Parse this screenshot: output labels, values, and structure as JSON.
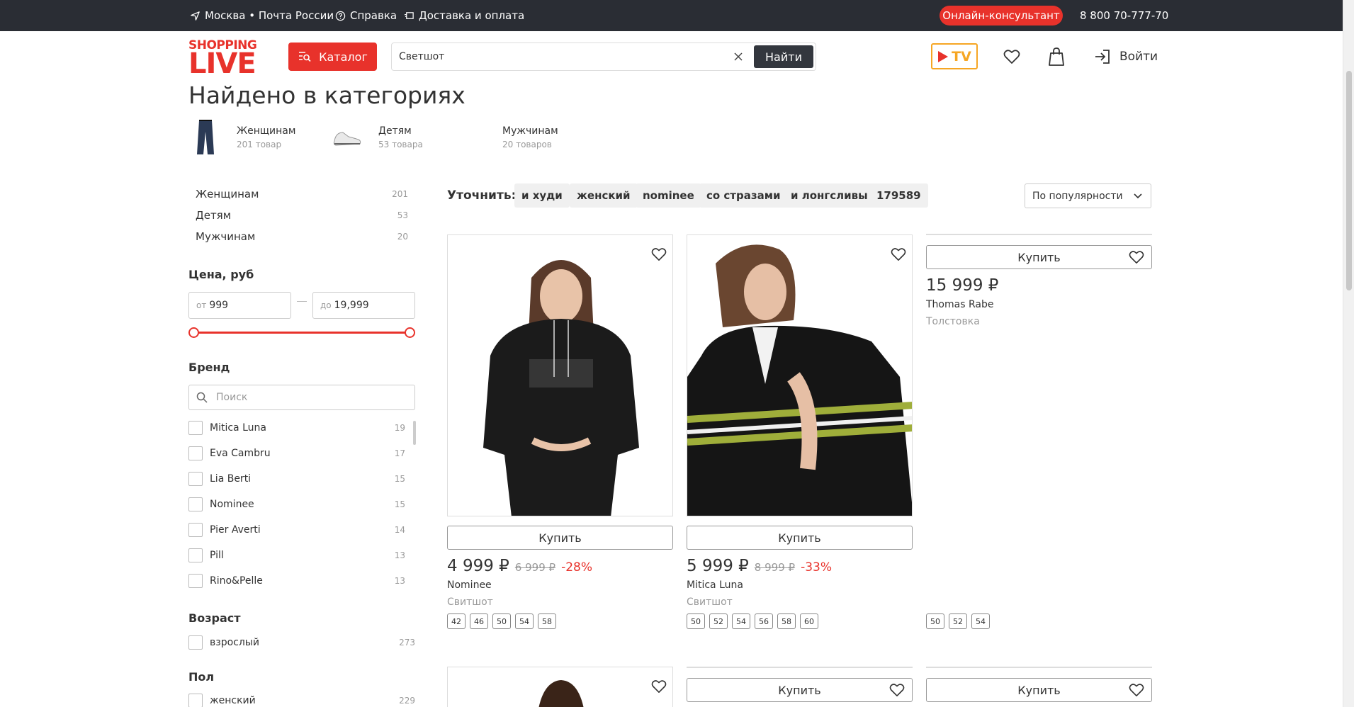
{
  "topbar": {
    "location": "Москва • Почта России",
    "help": "Справка",
    "delivery": "Доставка и оплата",
    "consultant": "Онлайн-консультант",
    "phone": "8 800 70-777-70"
  },
  "header": {
    "logo_top": "SHOPPING",
    "logo_bottom": "LIVE",
    "catalog_label": "Каталог",
    "search_value": "Светшот",
    "search_button": "Найти",
    "tv_label": "TV",
    "login_label": "Войти"
  },
  "page_title": "Найдено в категориях",
  "found_categories": [
    {
      "name": "Женщинам",
      "count": "201 товар"
    },
    {
      "name": "Детям",
      "count": "53 товара"
    },
    {
      "name": "Мужчинам",
      "count": "20 товаров"
    }
  ],
  "sidebar": {
    "categories": [
      {
        "name": "Женщинам",
        "count": "201"
      },
      {
        "name": "Детям",
        "count": "53"
      },
      {
        "name": "Мужчинам",
        "count": "20"
      }
    ],
    "price_heading": "Цена, руб",
    "price_from_prefix": "от",
    "price_from": "999",
    "price_to_prefix": "до",
    "price_to": "19,999",
    "brand_heading": "Бренд",
    "brand_search_placeholder": "Поиск",
    "brands": [
      {
        "name": "Mitica Luna",
        "count": "19"
      },
      {
        "name": "Eva Cambru",
        "count": "17"
      },
      {
        "name": "Lia Berti",
        "count": "15"
      },
      {
        "name": "Nominee",
        "count": "15"
      },
      {
        "name": "Pier Averti",
        "count": "14"
      },
      {
        "name": "Pill",
        "count": "13"
      },
      {
        "name": "Rino&Pelle",
        "count": "13"
      }
    ],
    "age_heading": "Возраст",
    "age_options": [
      {
        "name": "взрослый",
        "count": "273"
      }
    ],
    "gender_heading": "Пол",
    "gender_options": [
      {
        "name": "женский",
        "count": "229"
      }
    ]
  },
  "refine": {
    "label": "Уточнить:",
    "chips": [
      "и худи",
      "женский",
      "nominee",
      "со стразами",
      "и лонгсливы",
      "179589"
    ],
    "sort_value": "По популярности"
  },
  "products": [
    {
      "buy": "Купить",
      "price": "4 999 ₽",
      "old_price": "6 999 ₽",
      "discount": "-28%",
      "brand": "Nominee",
      "type": "Свитшот",
      "sizes": [
        "42",
        "46",
        "50",
        "54",
        "58"
      ]
    },
    {
      "buy": "Купить",
      "price": "5 999 ₽",
      "old_price": "8 999 ₽",
      "discount": "-33%",
      "brand": "Mitica Luna",
      "type": "Свитшот",
      "sizes": [
        "50",
        "52",
        "54",
        "56",
        "58",
        "60"
      ]
    },
    {
      "buy": "Купить",
      "price": "15 999 ₽",
      "brand": "Thomas Rabe",
      "type": "Толстовка",
      "sizes": [
        "50",
        "52",
        "54"
      ]
    }
  ],
  "row2": {
    "buy": "Купить"
  }
}
